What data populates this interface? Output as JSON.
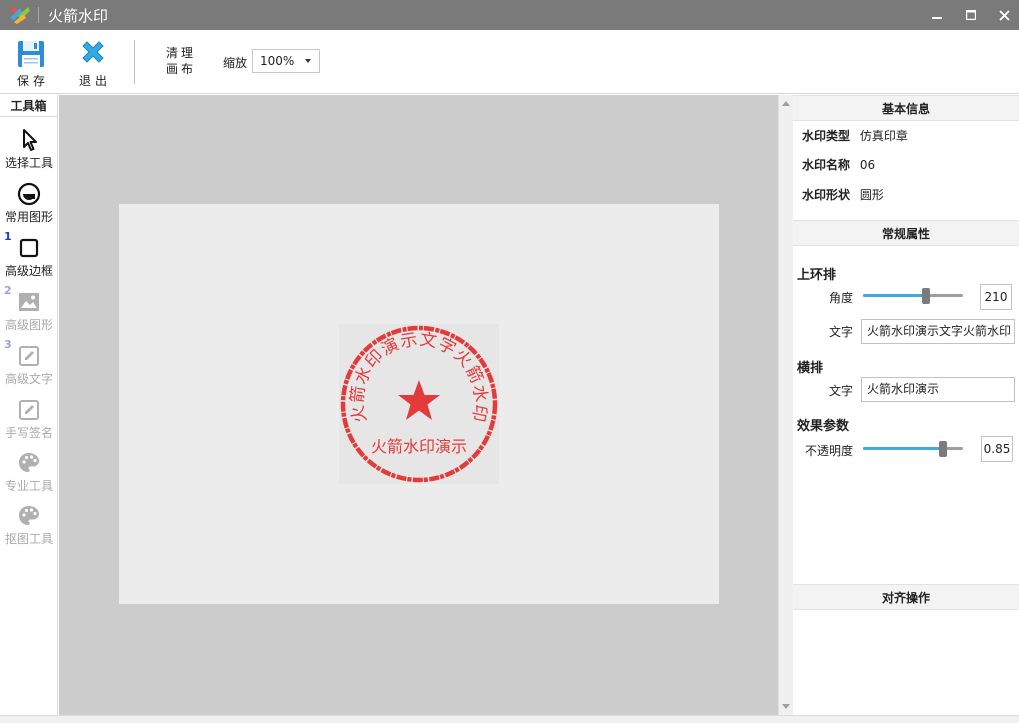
{
  "window": {
    "title": "火箭水印"
  },
  "toolbar": {
    "save_label": "保存",
    "exit_label": "退出",
    "clean_label_line1": "清理",
    "clean_label_line2": "画布",
    "zoom_label": "缩放",
    "zoom_value": "100%"
  },
  "toolbox": {
    "title": "工具箱",
    "items": [
      {
        "label": "选择工具",
        "icon": "cursor-icon",
        "enabled": true
      },
      {
        "label": "常用图形",
        "icon": "circle-shape-icon",
        "enabled": true
      },
      {
        "label": "高级边框",
        "icon": "square-frame-icon",
        "enabled": true,
        "number": "1"
      },
      {
        "label": "高级图形",
        "icon": "image-icon",
        "enabled": false,
        "number": "2"
      },
      {
        "label": "高级文字",
        "icon": "edit-text-icon",
        "enabled": false,
        "number": "3"
      },
      {
        "label": "手写签名",
        "icon": "signature-icon",
        "enabled": false
      },
      {
        "label": "专业工具",
        "icon": "palette-icon",
        "enabled": false
      },
      {
        "label": "抠图工具",
        "icon": "palette-icon",
        "enabled": false
      }
    ]
  },
  "stamp": {
    "top_arc_text": "火箭水印演示文字火箭水印",
    "bottom_text": "火箭水印演示",
    "color": "#e53a3a"
  },
  "panel": {
    "basic_info_title": "基本信息",
    "basic_info": [
      {
        "key": "水印类型",
        "value": "仿真印章"
      },
      {
        "key": "水印名称",
        "value": "06"
      },
      {
        "key": "水印形状",
        "value": "圆形"
      }
    ],
    "general_title": "常规属性",
    "upper_ring": {
      "group_label": "上环排",
      "angle_label": "角度",
      "angle_value": "210",
      "angle_fraction": 0.63,
      "text_label": "文字",
      "text_value": "火箭水印演示文字火箭水印"
    },
    "horizontal": {
      "group_label": "横排",
      "text_label": "文字",
      "text_value": "火箭水印演示"
    },
    "effect": {
      "group_label": "效果参数",
      "opacity_label": "不透明度",
      "opacity_value": "0.85",
      "opacity_fraction": 0.8
    },
    "align_title": "对齐操作"
  },
  "colors": {
    "accent": "#3fa9e0",
    "titlebar": "#7a7a7a",
    "stamp_red": "#e53a3a"
  }
}
